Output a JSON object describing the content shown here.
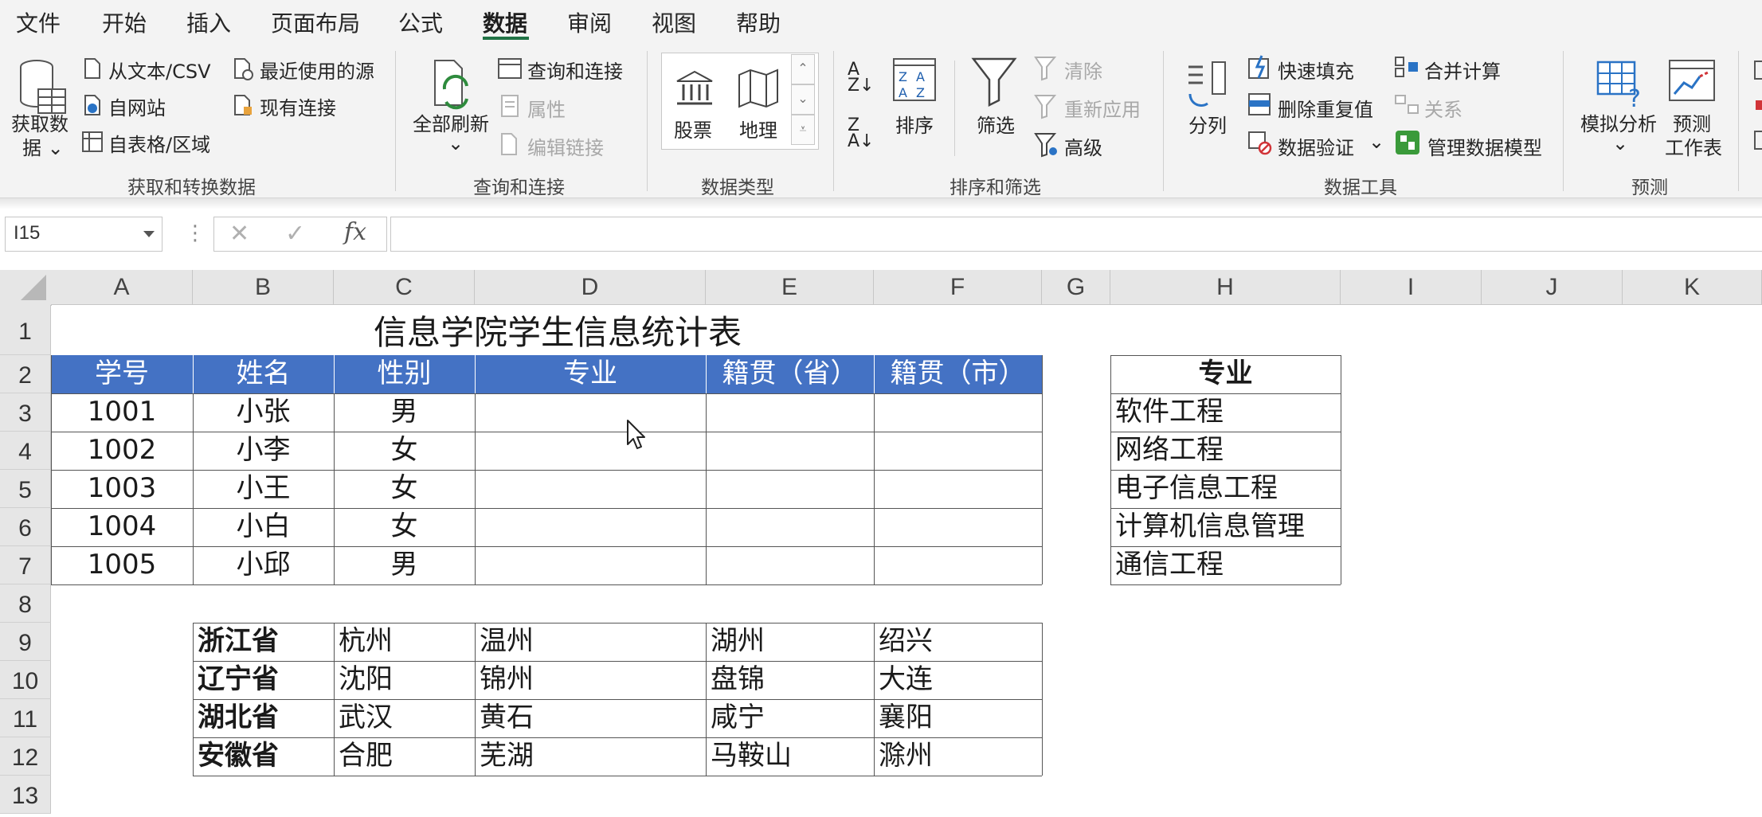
{
  "menu": {
    "items": [
      "文件",
      "开始",
      "插入",
      "页面布局",
      "公式",
      "数据",
      "审阅",
      "视图",
      "帮助"
    ],
    "active": "数据"
  },
  "ribbon": {
    "group1": {
      "get_data": "获取数",
      "get_data2": "据",
      "from_text_csv": "从文本/CSV",
      "recent_sources": "最近使用的源",
      "from_web": "自网站",
      "existing_connections": "现有连接",
      "from_table": "自表格/区域",
      "label": "获取和转换数据"
    },
    "group2": {
      "refresh_all": "全部刷新",
      "queries_connections": "查询和连接",
      "properties": "属性",
      "edit_links": "编辑链接",
      "label": "查询和连接"
    },
    "group3": {
      "stocks": "股票",
      "geography": "地理",
      "label": "数据类型"
    },
    "group4": {
      "sort": "排序",
      "filter": "筛选",
      "clear": "清除",
      "reapply": "重新应用",
      "advanced": "高级",
      "label": "排序和筛选"
    },
    "group5": {
      "text_to_columns": "分列",
      "flash_fill": "快速填充",
      "remove_duplicates": "删除重复值",
      "data_validation": "数据验证",
      "consolidate": "合并计算",
      "relationships": "关系",
      "manage_data_model": "管理数据模型",
      "label": "数据工具"
    },
    "group6": {
      "what_if": "模拟分析",
      "forecast_sheet_1": "预测",
      "forecast_sheet_2": "工作表",
      "label": "预测"
    }
  },
  "formula_bar": {
    "name_box": "I15",
    "fx": "fx",
    "value": ""
  },
  "columns": [
    "A",
    "B",
    "C",
    "D",
    "E",
    "F",
    "G",
    "H",
    "I",
    "J",
    "K"
  ],
  "rows": [
    "1",
    "2",
    "3",
    "4",
    "5",
    "6",
    "7",
    "8",
    "9",
    "10",
    "11",
    "12",
    "13"
  ],
  "sheet": {
    "title": "信息学院学生信息统计表",
    "headers": [
      "学号",
      "姓名",
      "性别",
      "专业",
      "籍贯（省）",
      "籍贯（市）"
    ],
    "students": [
      [
        "1001",
        "小张",
        "男"
      ],
      [
        "1002",
        "小李",
        "女"
      ],
      [
        "1003",
        "小王",
        "女"
      ],
      [
        "1004",
        "小白",
        "女"
      ],
      [
        "1005",
        "小邱",
        "男"
      ]
    ],
    "major_header": "专业",
    "majors": [
      "软件工程",
      "网络工程",
      "电子信息工程",
      "计算机信息管理",
      "通信工程"
    ],
    "provinces": [
      [
        "浙江省",
        "杭州",
        "温州",
        "湖州",
        "绍兴"
      ],
      [
        "辽宁省",
        "沈阳",
        "锦州",
        "盘锦",
        "大连"
      ],
      [
        "湖北省",
        "武汉",
        "黄石",
        "咸宁",
        "襄阳"
      ],
      [
        "安徽省",
        "合肥",
        "芜湖",
        "马鞍山",
        "滁州"
      ]
    ]
  },
  "colors": {
    "header_fill": "#4472c4",
    "accent": "#217346"
  }
}
